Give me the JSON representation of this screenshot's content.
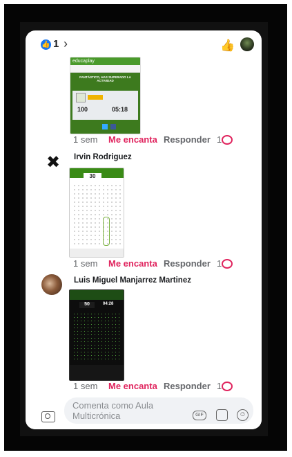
{
  "top_bar": {
    "like_count": "1",
    "chevron_glyph": "›"
  },
  "comment1": {
    "screenshot": {
      "app_name": "educaplay",
      "message": "FANTÁSTICO, HAS SUPERADO LA ACTIVIDAD",
      "score": "100",
      "time": "05:18"
    },
    "time": "1 sem",
    "love": "Me encanta",
    "reply": "Responder",
    "reaction_count": "1"
  },
  "comment2": {
    "author": "Irvin Rodriguez",
    "screenshot": {
      "counter": "30"
    },
    "time": "1 sem",
    "love": "Me encanta",
    "reply": "Responder",
    "reaction_count": "1"
  },
  "comment3": {
    "author": "Luis Miguel Manjarrez Martinez",
    "screenshot": {
      "counter": "50",
      "time": "04:28"
    },
    "time": "1 sem",
    "love": "Me encanta",
    "reply": "Responder",
    "reaction_count": "1"
  },
  "composer": {
    "placeholder": "Comenta como Aula Multicrónica",
    "gif_label": "GIF"
  },
  "icons": {
    "like": "like-icon",
    "thumb": "thumbs-up-icon",
    "heart": "heart-icon",
    "camera": "camera-icon",
    "gif": "gif-icon",
    "sticker": "sticker-icon",
    "emoji": "emoji-icon"
  },
  "colors": {
    "facebook_blue": "#1877f2",
    "love_red": "#e0245e",
    "educaplay_green": "#3d7a1e"
  }
}
